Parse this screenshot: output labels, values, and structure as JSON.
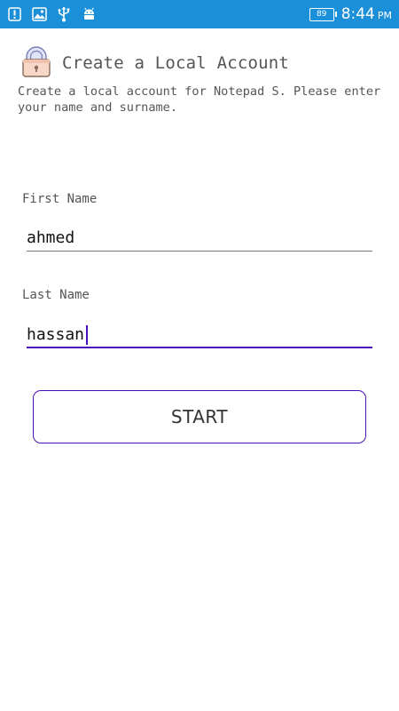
{
  "status_bar": {
    "icons": [
      "alert-icon",
      "image-icon",
      "usb-icon",
      "android-icon"
    ],
    "battery_level": "89",
    "time": "8:44",
    "ampm": "PM",
    "background_color": "#1c8fd9"
  },
  "header": {
    "icon": "lock-icon",
    "title": "Create a Local Account"
  },
  "description": "Create a local account for Notepad S. Please enter your name and surname.",
  "form": {
    "first_name": {
      "label": "First Name",
      "value": "ahmed"
    },
    "last_name": {
      "label": "Last Name",
      "value": "hassan"
    }
  },
  "start_button": {
    "label": "START"
  },
  "colors": {
    "accent": "#4a0fb8",
    "text": "#555555"
  }
}
